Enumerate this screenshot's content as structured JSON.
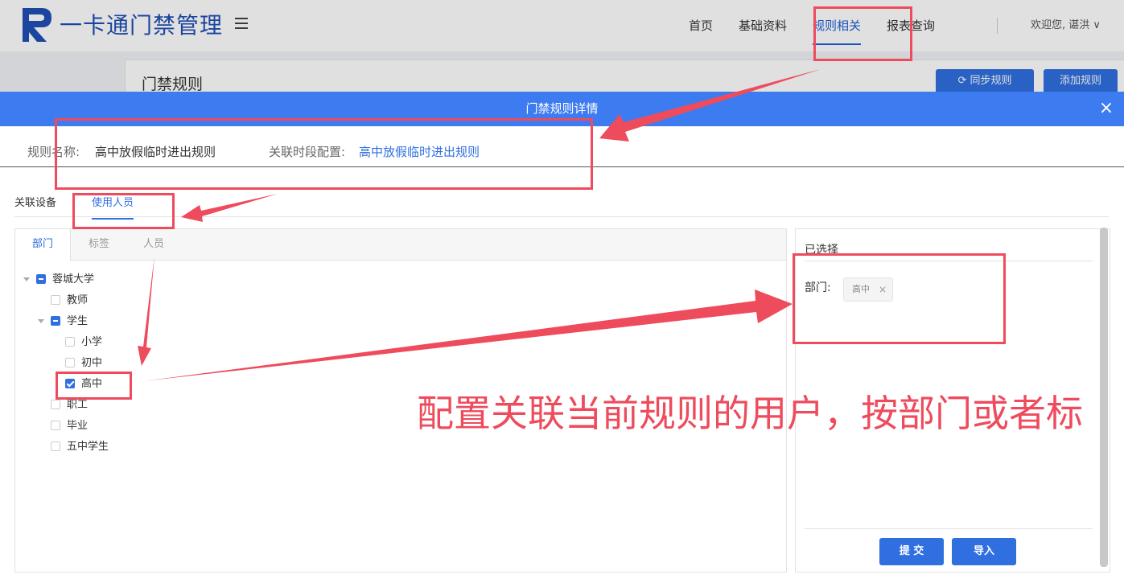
{
  "app": {
    "title": "一卡通门禁管理",
    "welcome": "欢迎您, 谌洪 ∨"
  },
  "nav": {
    "items": [
      {
        "label": "首页"
      },
      {
        "label": "基础资料"
      },
      {
        "label": "规则相关",
        "active": true
      },
      {
        "label": "报表查询"
      }
    ]
  },
  "page": {
    "title": "门禁规则",
    "sync_button": "⟳ 同步规则",
    "add_button": "添加规则"
  },
  "modal": {
    "title": "门禁规则详情",
    "close": "×",
    "rule_name_label": "规则名称:",
    "rule_name_value": "高中放假临时进出规则",
    "time_config_label": "关联时段配置:",
    "time_config_value": "高中放假临时进出规则",
    "tabs": [
      {
        "label": "关联设备"
      },
      {
        "label": "使用人员",
        "active": true
      }
    ],
    "sub_tabs": [
      {
        "label": "部门",
        "active": true
      },
      {
        "label": "标签"
      },
      {
        "label": "人员"
      }
    ],
    "tree": [
      {
        "label": "蓉城大学",
        "state": "indeterminate",
        "expanded": true
      },
      {
        "label": "教师",
        "state": "unchecked"
      },
      {
        "label": "学生",
        "state": "indeterminate",
        "expanded": true
      },
      {
        "label": "小学",
        "state": "unchecked"
      },
      {
        "label": "初中",
        "state": "unchecked"
      },
      {
        "label": "高中",
        "state": "checked"
      },
      {
        "label": "职工",
        "state": "unchecked"
      },
      {
        "label": "毕业",
        "state": "unchecked"
      },
      {
        "label": "五中学生",
        "state": "unchecked"
      }
    ],
    "selected": {
      "title": "已选择",
      "dept_label": "部门:",
      "tags": [
        {
          "label": "高中",
          "remove": "×"
        }
      ]
    },
    "submit_button": "提 交",
    "import_button": "导入"
  },
  "annotation": {
    "text": "配置关联当前规则的用户，按部门或者标"
  },
  "colors": {
    "primary": "#2f6fe0",
    "header": "#3d7bf0",
    "annotation": "#ee4b5d",
    "brand": "#1f4fb5"
  }
}
